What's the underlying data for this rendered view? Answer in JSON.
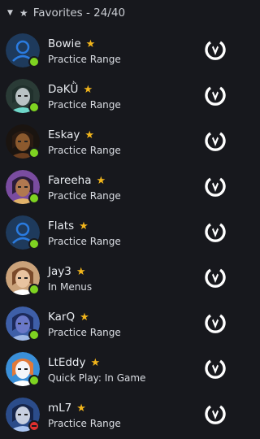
{
  "header": {
    "caret_icon": "caret-down-icon",
    "star_icon": "star-icon",
    "title": "Favorites - 24/40"
  },
  "colors": {
    "online": "#7ed321",
    "dnd": "#e0302f",
    "favorite_star": "#f2b51b",
    "game_icon": "#ffffff"
  },
  "friends": [
    {
      "name": "Bowie",
      "activity": "Practice Range",
      "status": "online",
      "avatar": "default-avatar",
      "game_icon": "overwatch-icon"
    },
    {
      "name": "DəKǛ",
      "activity": "Practice Range",
      "status": "online",
      "avatar": "hero-portrait",
      "game_icon": "overwatch-icon"
    },
    {
      "name": "Eskay",
      "activity": "Practice Range",
      "status": "online",
      "avatar": "hero-portrait",
      "game_icon": "overwatch-icon"
    },
    {
      "name": "Fareeha",
      "activity": "Practice Range",
      "status": "online",
      "avatar": "hero-portrait",
      "game_icon": "overwatch-icon"
    },
    {
      "name": "Flats",
      "activity": "Practice Range",
      "status": "online",
      "avatar": "default-avatar",
      "game_icon": "overwatch-icon"
    },
    {
      "name": "Jay3",
      "activity": "In Menus",
      "status": "online",
      "avatar": "hero-portrait",
      "game_icon": "overwatch-icon"
    },
    {
      "name": "KarQ",
      "activity": "Practice Range",
      "status": "online",
      "avatar": "hero-portrait",
      "game_icon": "overwatch-icon"
    },
    {
      "name": "LtEddy",
      "activity": "Quick Play: In Game",
      "status": "online",
      "avatar": "hero-portrait",
      "game_icon": "overwatch-icon"
    },
    {
      "name": "mL7",
      "activity": "Practice Range",
      "status": "dnd",
      "avatar": "hero-portrait",
      "game_icon": "overwatch-icon"
    }
  ]
}
